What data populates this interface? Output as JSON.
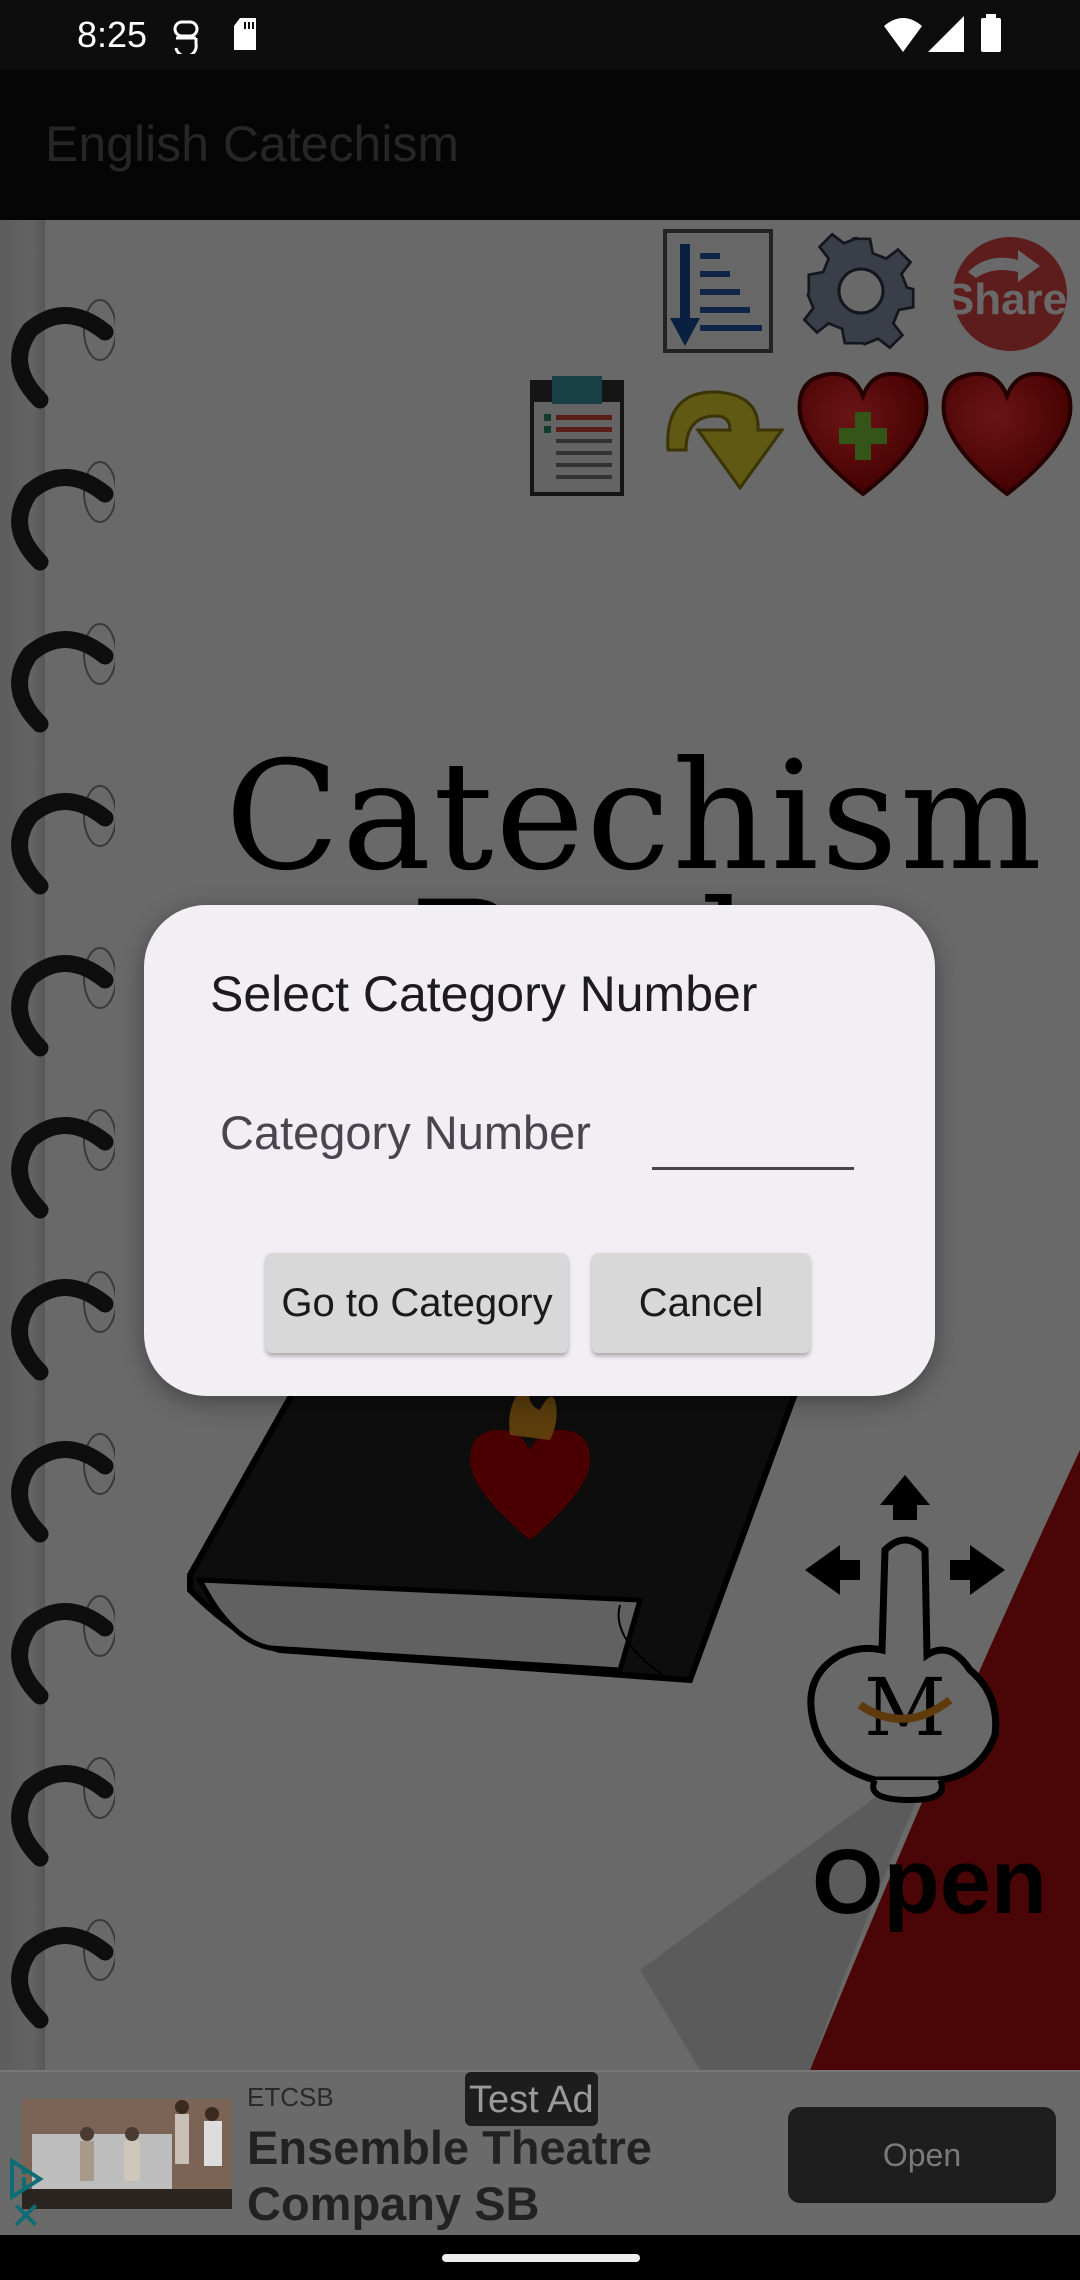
{
  "status_bar": {
    "time": "8:25",
    "left_icons": [
      "vpn-key-icon",
      "sd-card-icon"
    ],
    "right_icons": [
      "wifi-icon",
      "signal-icon",
      "battery-icon"
    ]
  },
  "app_bar": {
    "title": "English Catechism"
  },
  "toolbar": {
    "row1": [
      {
        "name": "sort-index-icon",
        "label": "Index"
      },
      {
        "name": "settings-gear-icon",
        "label": "Settings"
      },
      {
        "name": "share-icon",
        "label": "Share",
        "text": "Share"
      }
    ],
    "row2": [
      {
        "name": "clipboard-list-icon",
        "label": "List"
      },
      {
        "name": "redo-arrow-icon",
        "label": "Go to"
      },
      {
        "name": "heart-add-icon",
        "label": "Add favorite"
      },
      {
        "name": "heart-favorites-icon",
        "label": "Favorites"
      }
    ]
  },
  "background": {
    "title_line1": "Catechism",
    "title_line2": "Book",
    "gesture_hint": "Open",
    "accent_red": "#b01010"
  },
  "dialog": {
    "title": "Select Category Number",
    "field_label": "Category Number",
    "field_value": "",
    "field_placeholder": "",
    "buttons": {
      "go": "Go to Category",
      "cancel": "Cancel"
    }
  },
  "ad": {
    "badge": "Test Ad",
    "advertiser": "ETCSB",
    "headline": "Ensemble Theatre Company SB",
    "cta": "Open",
    "accent": "#0d6d74"
  }
}
